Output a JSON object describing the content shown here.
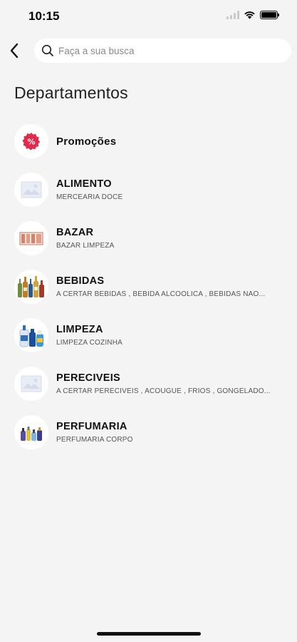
{
  "status": {
    "time": "10:15"
  },
  "search": {
    "placeholder": "Faça a sua busca"
  },
  "page": {
    "title": "Departamentos"
  },
  "departments": [
    {
      "name": "Promoções",
      "subtitle": "",
      "icon": "promo-percent-icon",
      "accent": "#e32a4a"
    },
    {
      "name": "ALIMENTO",
      "subtitle": "MERCEARIA DOCE",
      "icon": "image-placeholder-icon"
    },
    {
      "name": "BAZAR",
      "subtitle": "BAZAR LIMPEZA",
      "icon": "bazar-product-image"
    },
    {
      "name": "BEBIDAS",
      "subtitle": "A CERTAR BEBIDAS , BEBIDA  ALCOOLICA , BEBIDAS NAO...",
      "icon": "bottles-image"
    },
    {
      "name": "LIMPEZA",
      "subtitle": " LIMPEZA COZINHA",
      "icon": "cleaning-products-image"
    },
    {
      "name": "PERECIVEIS",
      "subtitle": "A CERTAR PERECIVEIS , ACOUGUE  , FRIOS , GONGELADO...",
      "icon": "image-placeholder-icon"
    },
    {
      "name": "PERFUMARIA",
      "subtitle": "PERFUMARIA CORPO",
      "icon": "perfume-products-image"
    }
  ]
}
